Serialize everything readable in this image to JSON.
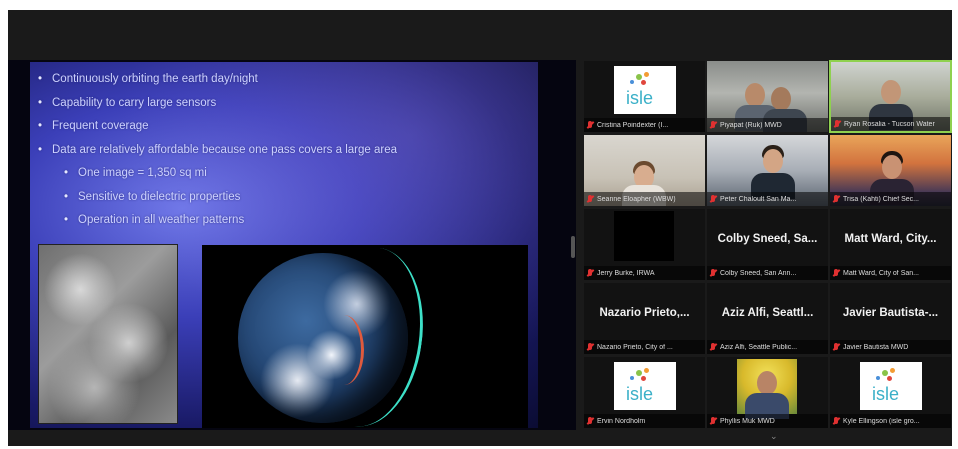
{
  "slide": {
    "bullets": [
      {
        "text": "Continuously orbiting the earth day/night",
        "level": 1
      },
      {
        "text": "Capability to carry large sensors",
        "level": 1
      },
      {
        "text": "Frequent coverage",
        "level": 1
      },
      {
        "text": "Data are relatively affordable because one pass covers a large area",
        "level": 1
      },
      {
        "text": "One image = 1,350 sq mi",
        "level": 2
      },
      {
        "text": "Sensitive to dielectric properties",
        "level": 2
      },
      {
        "text": "Operation in all weather patterns",
        "level": 2
      }
    ],
    "bullet_glyph": "•"
  },
  "participants": [
    {
      "tag": "Cristina Poindexter (I...",
      "big_name": "",
      "video": "isle-logo",
      "logo_text": "isle",
      "muted": true
    },
    {
      "tag": "Piyapat (Ruk) MWD",
      "big_name": "",
      "video": "office",
      "muted": true
    },
    {
      "tag": "Ryan Rosalia - Tucson Water",
      "big_name": "",
      "video": "lab",
      "muted": true,
      "active_speaker": true
    },
    {
      "tag": "Seanne Eloapher (WBW)",
      "big_name": "",
      "video": "woman",
      "muted": true
    },
    {
      "tag": "Peter Chaloult San Ma...",
      "big_name": "",
      "video": "man",
      "muted": true
    },
    {
      "tag": "Trisa (Kahti) Chief Sec...",
      "big_name": "",
      "video": "sunset",
      "muted": true
    },
    {
      "tag": "Jerry Burke, IRWA",
      "big_name": "",
      "video": "black",
      "muted": true
    },
    {
      "tag": "Colby Sneed, San Ann...",
      "big_name": "Colby Sneed, Sa...",
      "video": "none",
      "muted": true
    },
    {
      "tag": "Matt Ward, City of San...",
      "big_name": "Matt Ward, City...",
      "video": "none",
      "muted": true
    },
    {
      "tag": "Nazario Prieto, City of ...",
      "big_name": "Nazario Prieto,...",
      "video": "none",
      "muted": true
    },
    {
      "tag": "Aziz Alfi, Seattle Public...",
      "big_name": "Aziz Alfi, Seattl...",
      "video": "none",
      "muted": true
    },
    {
      "tag": "Javier Bautista MWD",
      "big_name": "Javier Bautista-...",
      "video": "none",
      "muted": true
    },
    {
      "tag": "Ervin Nordholm",
      "big_name": "",
      "video": "isle-logo",
      "logo_text": "isle",
      "muted": true
    },
    {
      "tag": "Phyllis Muk MWD",
      "big_name": "",
      "video": "yellow",
      "muted": true
    },
    {
      "tag": "Kyle Ellingson (isle gro...",
      "big_name": "",
      "video": "isle-logo",
      "logo_text": "isle",
      "muted": true
    }
  ],
  "icons": {
    "muted": "mic-muted-icon",
    "gallery_next": "chevron-down-icon"
  },
  "colors": {
    "background": "#1a1a1a",
    "active_speaker_border": "#8fd14f",
    "muted_mic": "#e03131",
    "logo_text": "#3bb0c8"
  },
  "bottom": {
    "chevron": "⌄"
  }
}
